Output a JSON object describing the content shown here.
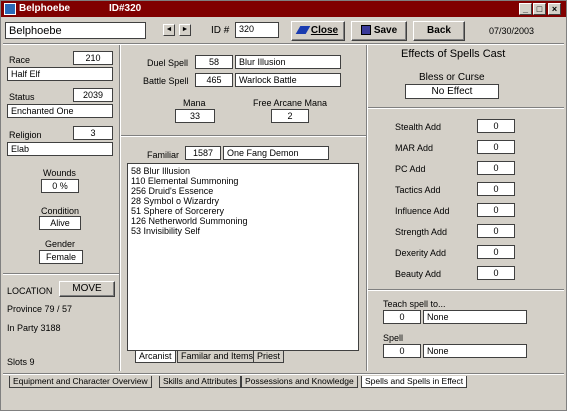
{
  "window": {
    "title": "Belphoebe",
    "id_title": "ID#320",
    "controls": {
      "minimize": "_",
      "maximize": "□",
      "close": "×"
    }
  },
  "header": {
    "name_value": "Belphoebe",
    "id_label": "ID #",
    "id_value": "320",
    "close_label": "Close",
    "save_label": "Save",
    "back_label": "Back",
    "date": "07/30/2003",
    "prev_icon": "◄",
    "next_icon": "►"
  },
  "left": {
    "race_label": "Race",
    "race_num": "210",
    "race_value": "Half Elf",
    "status_label": "Status",
    "status_num": "2039",
    "status_value": "Enchanted One",
    "religion_label": "Religion",
    "religion_num": "3",
    "religion_value": "Elab",
    "wounds_label": "Wounds",
    "wounds_value": "0 %",
    "condition_label": "Condition",
    "condition_value": "Alive",
    "gender_label": "Gender",
    "gender_value": "Female",
    "location_label": "LOCATION",
    "move_label": "MOVE",
    "province": "Province 79 / 57",
    "in_party": "In Party 3188",
    "slots": "Slots 9"
  },
  "middle": {
    "duel_spell_label": "Duel Spell",
    "duel_spell_num": "58",
    "duel_spell_name": "Blur Illusion",
    "battle_spell_label": "Battle Spell",
    "battle_spell_num": "465",
    "battle_spell_name": "Warlock Battle",
    "mana_label": "Mana",
    "mana_value": "33",
    "free_mana_label": "Free Arcane Mana",
    "free_mana_value": "2",
    "familiar_label": "Familiar",
    "familiar_num": "1587",
    "familiar_name": "One Fang Demon",
    "spells": [
      "58  Blur Illusion",
      "110 Elemental Summoning",
      "256 Druid's Essence",
      "28  Symbol o Wizardry",
      "51  Sphere of Sorcerery",
      "126 Netherworld Summoning",
      "53  Invisibility Self"
    ],
    "subtabs": [
      "Arcanist",
      "Familar and Items",
      "Priest"
    ]
  },
  "right": {
    "effects_title": "Effects of Spells Cast",
    "bless_label": "Bless or Curse",
    "bless_value": "No Effect",
    "adds": [
      {
        "label": "Stealth Add",
        "value": "0"
      },
      {
        "label": "MAR Add",
        "value": "0"
      },
      {
        "label": "PC Add",
        "value": "0"
      },
      {
        "label": "Tactics Add",
        "value": "0"
      },
      {
        "label": "Influence Add",
        "value": "0"
      },
      {
        "label": "Strength Add",
        "value": "0"
      },
      {
        "label": "Dexerity Add",
        "value": "0"
      },
      {
        "label": "Beauty Add",
        "value": "0"
      }
    ],
    "teach_label": "Teach spell to...",
    "teach_num": "0",
    "teach_name": "None",
    "spell_label": "Spell",
    "spell_num": "0",
    "spell_name": "None"
  },
  "bottom_tabs": [
    "Equipment and Character Overview",
    "Skills and Attributes",
    "Possessions and Knowledge",
    "Spells and Spells in Effect"
  ],
  "colors": {
    "title_bg": "#800000",
    "face": "#d4d0c8",
    "field_bg": "#ffffff"
  }
}
